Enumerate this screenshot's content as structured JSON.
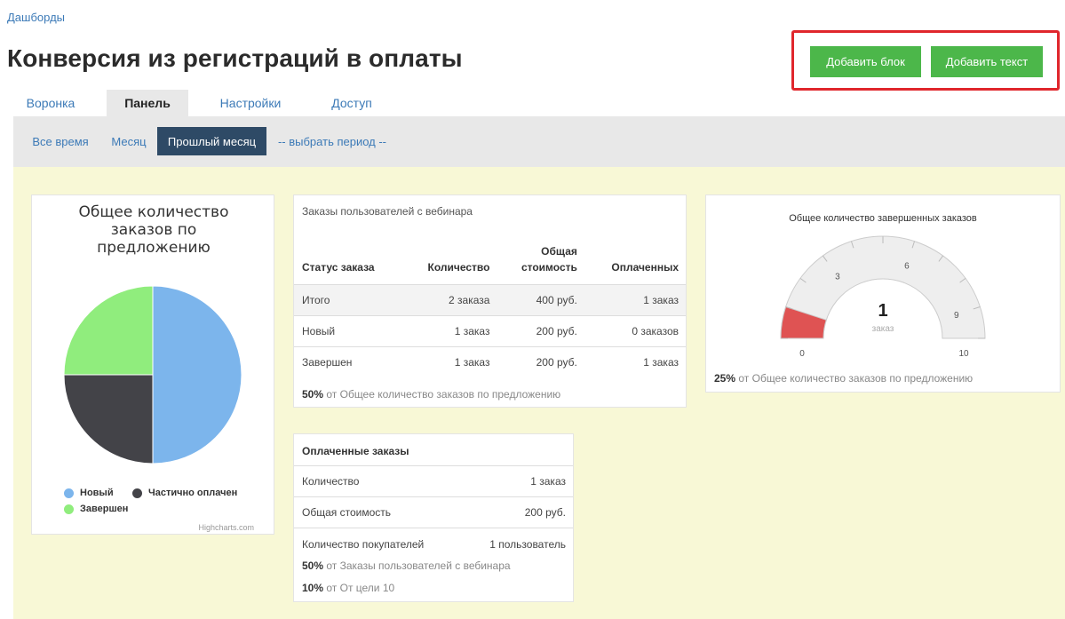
{
  "breadcrumb": "Дашборды",
  "page_title": "Конверсия из регистраций в оплаты",
  "actions": {
    "add_block": "Добавить блок",
    "add_text": "Добавить текст"
  },
  "tabs": [
    {
      "label": "Воронка",
      "active": false
    },
    {
      "label": "Панель",
      "active": true
    },
    {
      "label": "Настройки",
      "active": false
    },
    {
      "label": "Доступ",
      "active": false
    }
  ],
  "periods": [
    {
      "label": "Все время",
      "active": false
    },
    {
      "label": "Месяц",
      "active": false
    },
    {
      "label": "Прошлый месяц",
      "active": true
    },
    {
      "label": "-- выбрать период --",
      "active": false
    }
  ],
  "colors": {
    "accent_green": "#4cb74a",
    "highlight_red": "#e0262c",
    "active_period": "#2e4a66",
    "link_blue": "#3c7ab7",
    "content_bg": "#f8f8d6"
  },
  "pie_widget": {
    "title_lines": [
      "Общее количество",
      "заказов по",
      "предложению"
    ],
    "legend": {
      "new": "Новый",
      "partial": "Частично оплачен",
      "done": "Завершен"
    },
    "credit": "Highcharts.com"
  },
  "chart_data": [
    {
      "type": "pie",
      "title": "Общее количество заказов по предложению",
      "categories": [
        "Новый",
        "Частично оплачен",
        "Завершен"
      ],
      "values": [
        50,
        25,
        25
      ],
      "colors": [
        "#7cb5ec",
        "#434348",
        "#90ed7d"
      ],
      "legend_position": "bottom"
    },
    {
      "type": "gauge",
      "title": "Общее количество завершенных заказов",
      "value": 1,
      "unit": "заказ",
      "range": [
        0,
        10
      ],
      "ticks": [
        0,
        3,
        6,
        9,
        10
      ],
      "fill_color": "#df5353"
    }
  ],
  "orders_widget": {
    "caption": "Заказы пользователей с вебинара",
    "headers": {
      "status": "Статус заказа",
      "count": "Количество",
      "total_line1": "Общая",
      "total_line2": "стоимость",
      "paid": "Оплаченных"
    },
    "rows": [
      {
        "status": "Итого",
        "count": "2 заказа",
        "total": "400 руб.",
        "paid": "1 заказ"
      },
      {
        "status": "Новый",
        "count": "1 заказ",
        "total": "200 руб.",
        "paid": "0 заказов"
      },
      {
        "status": "Завершен",
        "count": "1 заказ",
        "total": "200 руб.",
        "paid": "1 заказ"
      }
    ],
    "footnote_pct": "50%",
    "footnote_text": " от Общее количество заказов по предложению"
  },
  "paid_widget": {
    "header": "Оплаченные заказы",
    "rows": [
      {
        "label": "Количество",
        "value": "1 заказ"
      },
      {
        "label": "Общая стоимость",
        "value": "200 руб."
      },
      {
        "label": "Количество покупателей",
        "value": "1 пользователь"
      }
    ],
    "note1_pct": "50%",
    "note1_text": " от Заказы пользователей с вебинара",
    "note2_pct": "10%",
    "note2_text": " от От цели 10"
  },
  "gauge_widget": {
    "title": "Общее количество завершенных заказов",
    "value": "1",
    "unit": "заказ",
    "tick_labels": [
      "0",
      "3",
      "6",
      "9",
      "10"
    ],
    "footnote_pct": "25%",
    "footnote_text": " от Общее количество заказов по предложению"
  }
}
